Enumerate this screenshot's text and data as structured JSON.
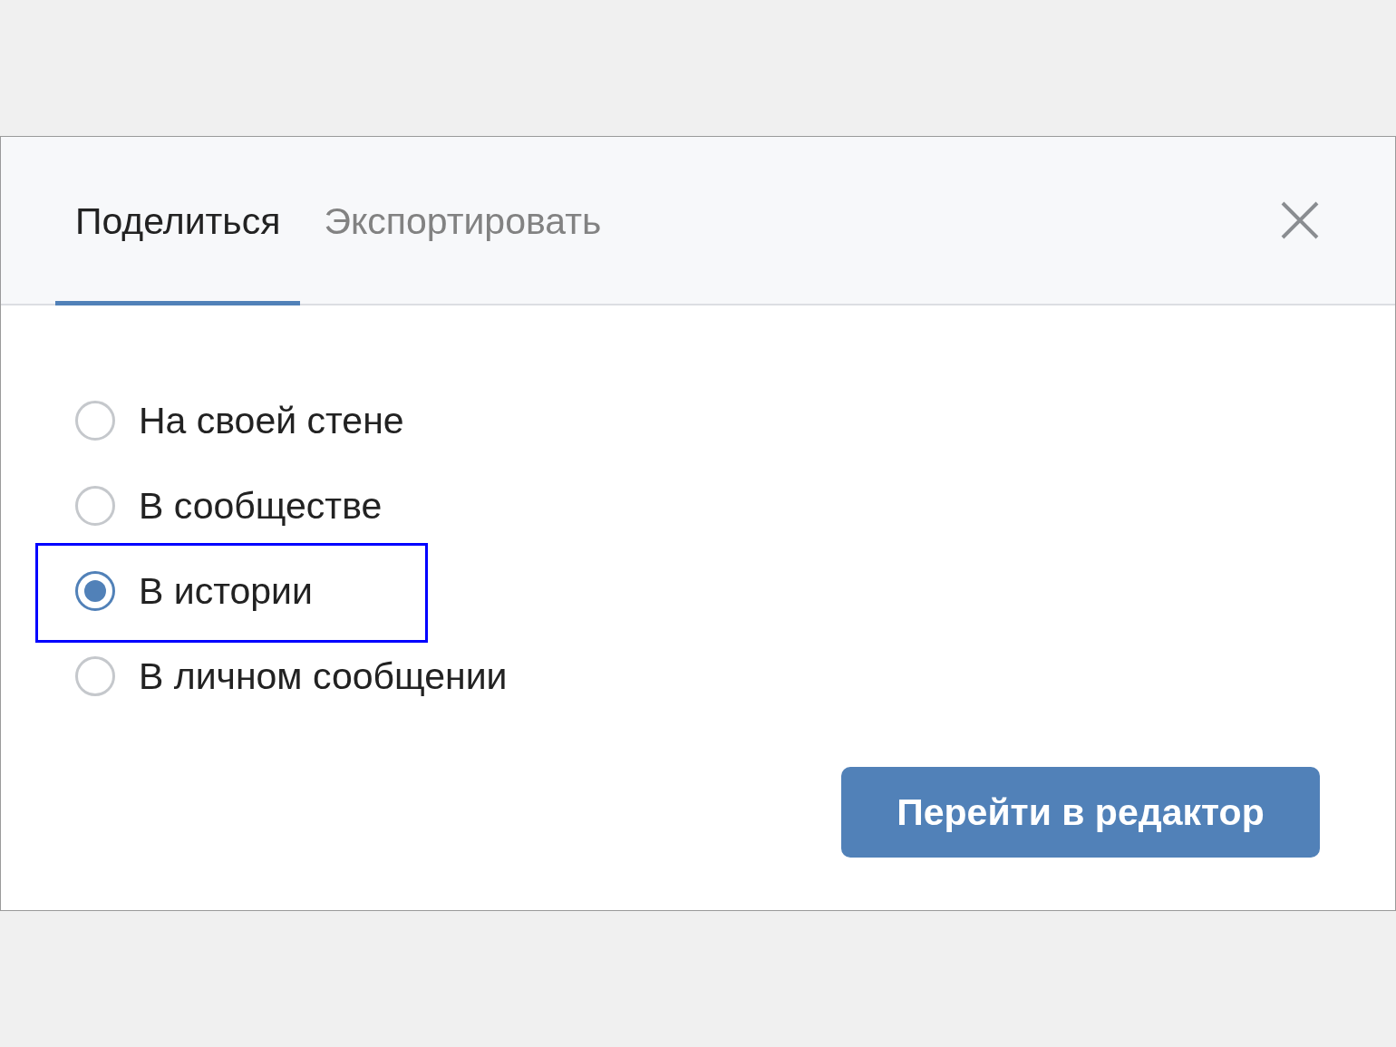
{
  "tabs": [
    {
      "label": "Поделиться",
      "selected": true
    },
    {
      "label": "Экспортировать",
      "selected": false
    }
  ],
  "options": [
    {
      "label": "На своей стене",
      "selected": false,
      "highlighted": false
    },
    {
      "label": "В сообществе",
      "selected": false,
      "highlighted": false
    },
    {
      "label": "В истории",
      "selected": true,
      "highlighted": true
    },
    {
      "label": "В личном сообщении",
      "selected": false,
      "highlighted": false
    }
  ],
  "button": "Перейти в редактор"
}
